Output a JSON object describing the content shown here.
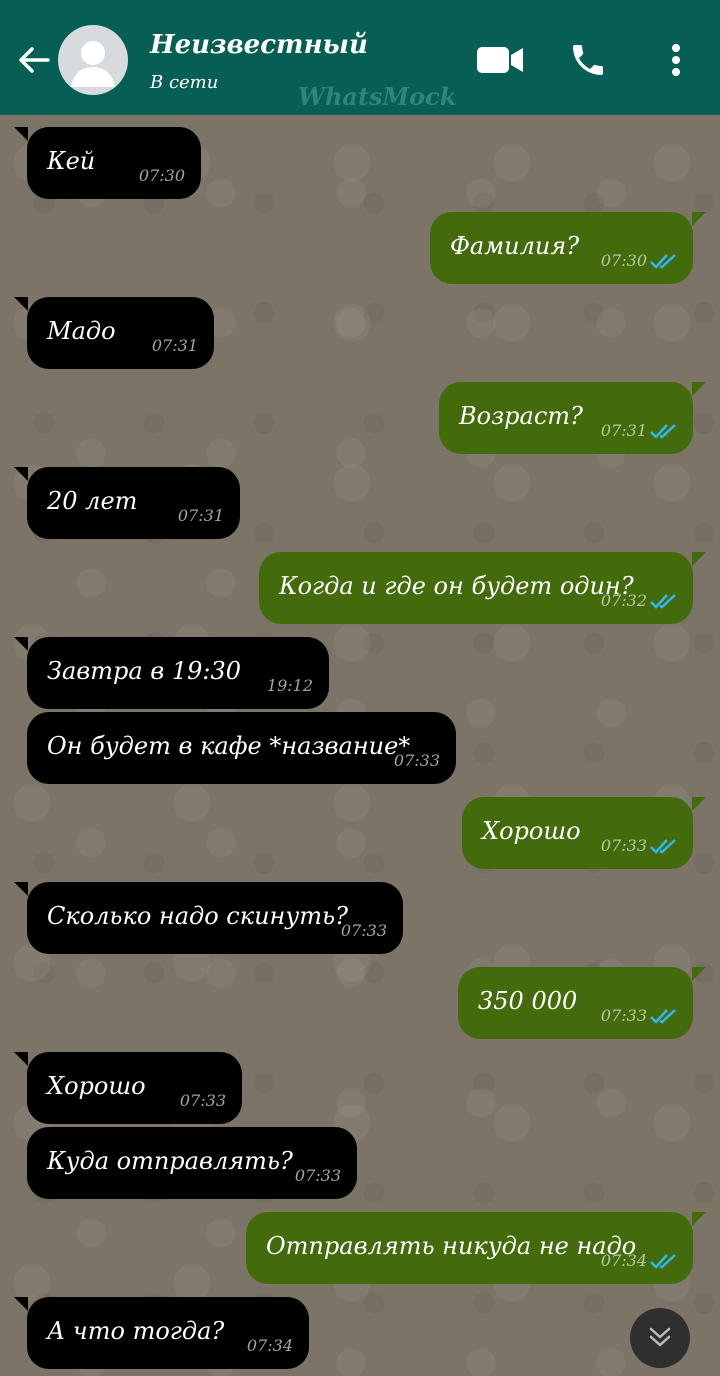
{
  "header": {
    "contact_name": "Неизвестный",
    "status": "В сети",
    "watermark": "WhatsMock",
    "icons": [
      "back-arrow-icon",
      "video-camera-icon",
      "phone-icon",
      "more-vertical-icon"
    ]
  },
  "colors": {
    "header": "#075e55",
    "incoming_bubble": "#000000",
    "outgoing_bubble": "#436b0c",
    "read_ticks": "#34b7f1"
  },
  "messages": [
    {
      "dir": "in",
      "text": "Кей",
      "time": "07:30"
    },
    {
      "dir": "out",
      "text": "Фамилия?",
      "time": "07:30",
      "read": true
    },
    {
      "dir": "in",
      "text": "Мадо",
      "time": "07:31"
    },
    {
      "dir": "out",
      "text": "Возраст?",
      "time": "07:31",
      "read": true
    },
    {
      "dir": "in",
      "text": "20 лет",
      "time": "07:31"
    },
    {
      "dir": "out",
      "text": "Когда и где он будет один?",
      "time": "07:32",
      "read": true
    },
    {
      "dir": "in",
      "text": "Завтра в 19:30",
      "time": "19:12"
    },
    {
      "dir": "in",
      "text": "Он будет в кафе *название*",
      "time": "07:33"
    },
    {
      "dir": "out",
      "text": "Хорошо",
      "time": "07:33",
      "read": true
    },
    {
      "dir": "in",
      "text": "Сколько надо скинуть?",
      "time": "07:33"
    },
    {
      "dir": "out",
      "text": "350 000",
      "time": "07:33",
      "read": true
    },
    {
      "dir": "in",
      "text": "Хорошо",
      "time": "07:33"
    },
    {
      "dir": "in",
      "text": "Куда отправлять?",
      "time": "07:33"
    },
    {
      "dir": "out",
      "text": "Отправлять никуда не надо",
      "time": "07:34",
      "read": true
    },
    {
      "dir": "in",
      "text": "А что тогда?",
      "time": "07:34"
    }
  ]
}
